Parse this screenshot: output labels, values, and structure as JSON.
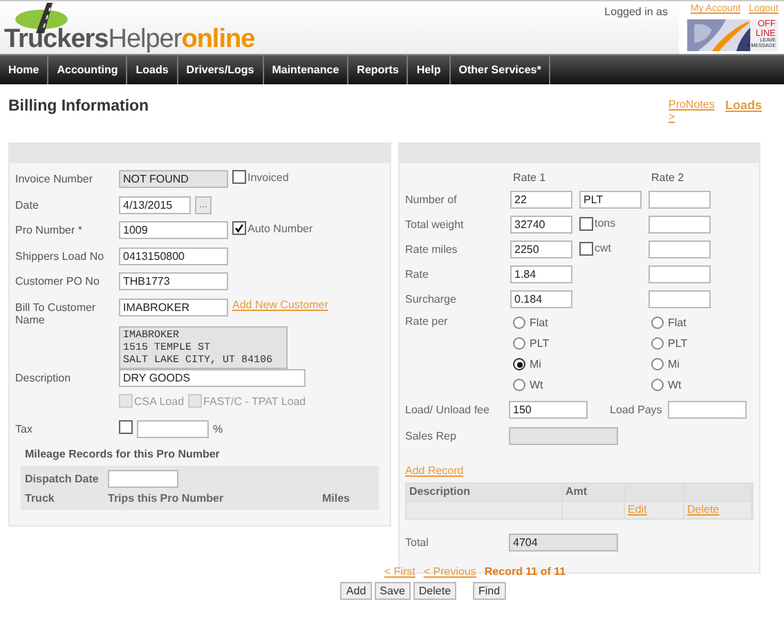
{
  "header": {
    "logo": {
      "dark": "Truckers",
      "light": "Helper",
      "accent": "online"
    },
    "logged_in": "Logged in as",
    "links": [
      "My Account",
      "Logout"
    ],
    "badge": {
      "status_lines": [
        "OFF",
        "LINE"
      ],
      "message_lines": [
        "LEAVE",
        "A MESSAGE"
      ]
    }
  },
  "nav": [
    "Home",
    "Accounting",
    "Loads",
    "Drivers/Logs",
    "Maintenance",
    "Reports",
    "Help",
    "Other Services*"
  ],
  "page": {
    "title": "Billing Information",
    "side_links": [
      {
        "label": "ProNotes >",
        "kind": "minor"
      },
      {
        "label": "Loads",
        "kind": "major"
      }
    ]
  },
  "left": {
    "rows": [
      {
        "label": "Invoice Number",
        "controls": [
          {
            "kind": "field",
            "value": "NOT FOUND",
            "disabled": true
          },
          {
            "kind": "checkbox",
            "label": "Invoiced",
            "checked": false,
            "disabled": false
          }
        ]
      },
      {
        "label": "Date",
        "controls": [
          {
            "kind": "date",
            "value": "4/13/2015",
            "disabled": false
          },
          {
            "kind": "button",
            "label": "..."
          }
        ]
      },
      {
        "label": "Pro Number *",
        "controls": [
          {
            "kind": "field",
            "value": "1009",
            "disabled": false
          },
          {
            "kind": "checkbox",
            "label": "Auto Number",
            "checked": true,
            "disabled": false
          }
        ]
      },
      {
        "label": "Shippers Load No",
        "controls": [
          {
            "kind": "field",
            "value": "0413150800",
            "disabled": false
          }
        ]
      },
      {
        "label": "Customer PO No",
        "controls": [
          {
            "kind": "field",
            "value": "THB1773",
            "disabled": false
          }
        ]
      },
      {
        "label": "Bill To Customer Name",
        "controls": [
          {
            "kind": "field",
            "value": "IMABROKER",
            "disabled": false
          },
          {
            "kind": "link",
            "label": "Add New Customer"
          }
        ]
      },
      {
        "controls": [
          {
            "kind": "address",
            "lines": [
              "IMABROKER",
              "1515 TEMPLE ST",
              "SALT LAKE CITY, UT 84106"
            ],
            "disabled": true
          }
        ]
      },
      {
        "label": "Description",
        "controls": [
          {
            "kind": "wide",
            "value": "DRY GOODS",
            "disabled": false
          }
        ]
      },
      {
        "controls": [
          {
            "kind": "checkbox",
            "label": "CSA Load",
            "checked": false,
            "disabled": true
          },
          {
            "kind": "checkbox",
            "label": "FAST/C - TPAT Load",
            "checked": false,
            "disabled": true
          }
        ]
      },
      {
        "label": "Tax",
        "controls": [
          {
            "kind": "checkbox",
            "checked": false,
            "disabled": false
          },
          {
            "kind": "date",
            "disabled": false
          },
          {
            "kind": "text",
            "label": "%"
          }
        ]
      }
    ],
    "mileage": {
      "title": "Mileage Records for this Pro Number",
      "dispatch_label": "Dispatch Date",
      "columns": [
        "Truck",
        "Trips this Pro Number",
        "Miles"
      ]
    }
  },
  "right": {
    "column_heads": [
      "Rate 1",
      "Rate 2"
    ],
    "rows": [
      {
        "label": "Number of",
        "rate1": "22",
        "extra": {
          "kind": "field",
          "value": "PLT"
        }
      },
      {
        "label": "Total weight",
        "rate1": "32740",
        "extra": {
          "kind": "checkbox",
          "label": "tons",
          "checked": false
        }
      },
      {
        "label": "Rate miles",
        "rate1": "2250",
        "extra": {
          "kind": "checkbox",
          "label": "cwt",
          "checked": false
        }
      },
      {
        "label": "Rate",
        "rate1": "1.84"
      },
      {
        "label": "Surcharge",
        "rate1": "0.184"
      }
    ],
    "rate_per": {
      "label": "Rate per",
      "rate1": [
        {
          "label": "Flat",
          "selected": false
        },
        {
          "label": "PLT",
          "selected": false
        },
        {
          "label": "Mi",
          "selected": true
        },
        {
          "label": "Wt",
          "selected": false
        }
      ],
      "rate2": [
        {
          "label": "Flat",
          "selected": false
        },
        {
          "label": "PLT",
          "selected": false
        },
        {
          "label": "Mi",
          "selected": false
        },
        {
          "label": "Wt",
          "selected": false
        }
      ]
    },
    "load_fee": {
      "label": "Load/ Unload fee",
      "value": "150"
    },
    "load_pays": {
      "label": "Load Pays"
    },
    "sales_rep": {
      "label": "Sales Rep",
      "disabled": true
    },
    "add_record": "Add Record",
    "table": {
      "columns": [
        "Description",
        "Amt"
      ],
      "row_actions": [
        "Edit",
        "Delete"
      ]
    },
    "total": {
      "label": "Total",
      "value": "4704"
    }
  },
  "pager": {
    "links": [
      "< First",
      "< Previous"
    ],
    "record": "Record 11 of 11"
  },
  "buttons": [
    "Add",
    "Save",
    "Delete"
  ],
  "find_button": "Find"
}
